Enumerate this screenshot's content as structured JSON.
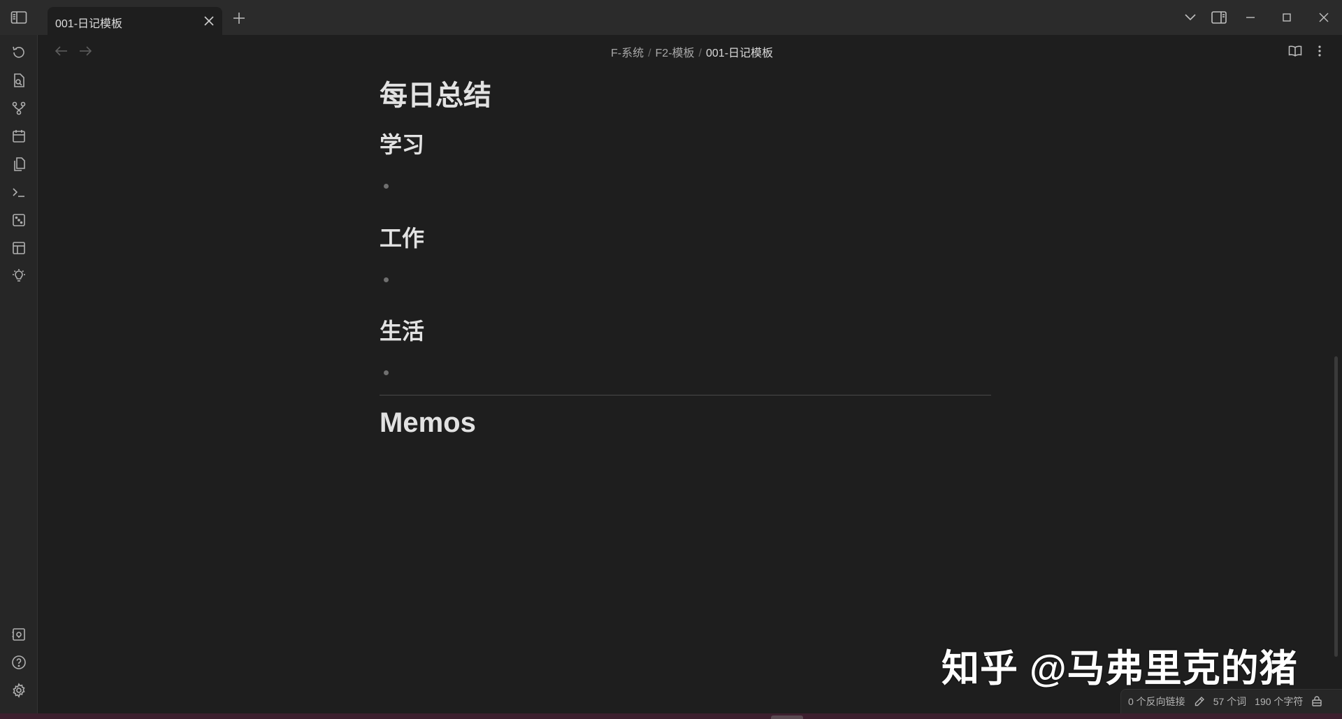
{
  "tab": {
    "title": "001-日记模板"
  },
  "breadcrumb": {
    "part1": "F-系统",
    "sep": "/",
    "part2": "F2-模板",
    "current": "001-日记模板"
  },
  "document": {
    "title": "每日总结",
    "sections": [
      "学习",
      "工作",
      "生活"
    ],
    "memos_heading": "Memos"
  },
  "statusbar": {
    "backlinks": "0 个反向链接",
    "words": "57 个词",
    "chars": "190 个字符"
  },
  "watermark": "知乎 @马弗里克的猪",
  "colors": {
    "background": "#1e1e1e",
    "titlebar": "#2b2b2b",
    "ribbon": "#262626",
    "text": "#dadada"
  },
  "icons": {
    "ribbon": [
      "history-icon",
      "file-search-icon",
      "git-branch-icon",
      "calendar-icon",
      "copy-files-icon",
      "terminal-icon",
      "dice-icon",
      "layout-template-icon",
      "lightbulb-icon"
    ],
    "ribbon_bottom": [
      "vault-icon",
      "help-icon",
      "settings-icon"
    ]
  }
}
